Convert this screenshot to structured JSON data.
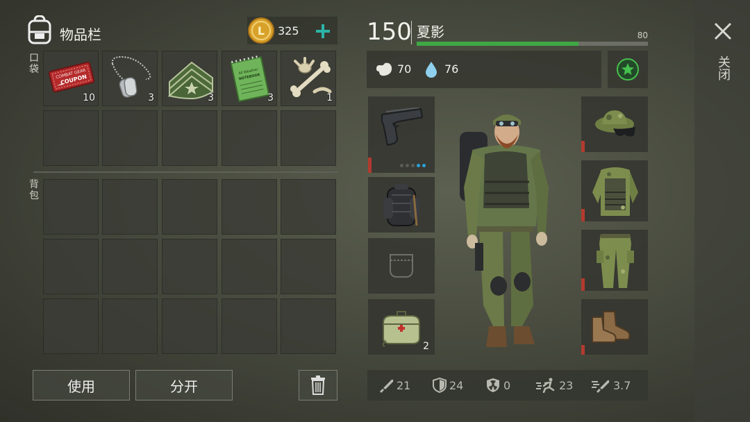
{
  "inventory": {
    "title": "物品栏",
    "coins": "325",
    "pocket_label": "口袋",
    "backpack_label": "背包",
    "pocket_items": [
      {
        "name": "combat-gear-coupon",
        "count": "10",
        "coupon_line1": "COMBAT GEAR",
        "coupon_line2": "COUPON"
      },
      {
        "name": "dog-tags",
        "count": "3"
      },
      {
        "name": "sergeant-insignia",
        "count": "3"
      },
      {
        "name": "notebook",
        "count": "3",
        "notebook_line1": "All Weather",
        "notebook_line2": "NOTEBOOK"
      },
      {
        "name": "bones",
        "count": "1"
      }
    ]
  },
  "buttons": {
    "use": "使用",
    "split": "分开"
  },
  "player": {
    "level": "150",
    "name": "夏影",
    "bar_max": "80",
    "bar_fill": 0.7,
    "hunger": "70",
    "thirst": "76"
  },
  "equipment": {
    "medkit_count": "2"
  },
  "stats": {
    "attack": "21",
    "defense": "24",
    "radiation": "0",
    "speed": "23",
    "attack_speed": "3.7"
  },
  "close_label": "关闭",
  "colors": {
    "health_bar": "#3ea845",
    "low_durability": "#b23a2e",
    "accent_teal": "#2bb5a8"
  }
}
